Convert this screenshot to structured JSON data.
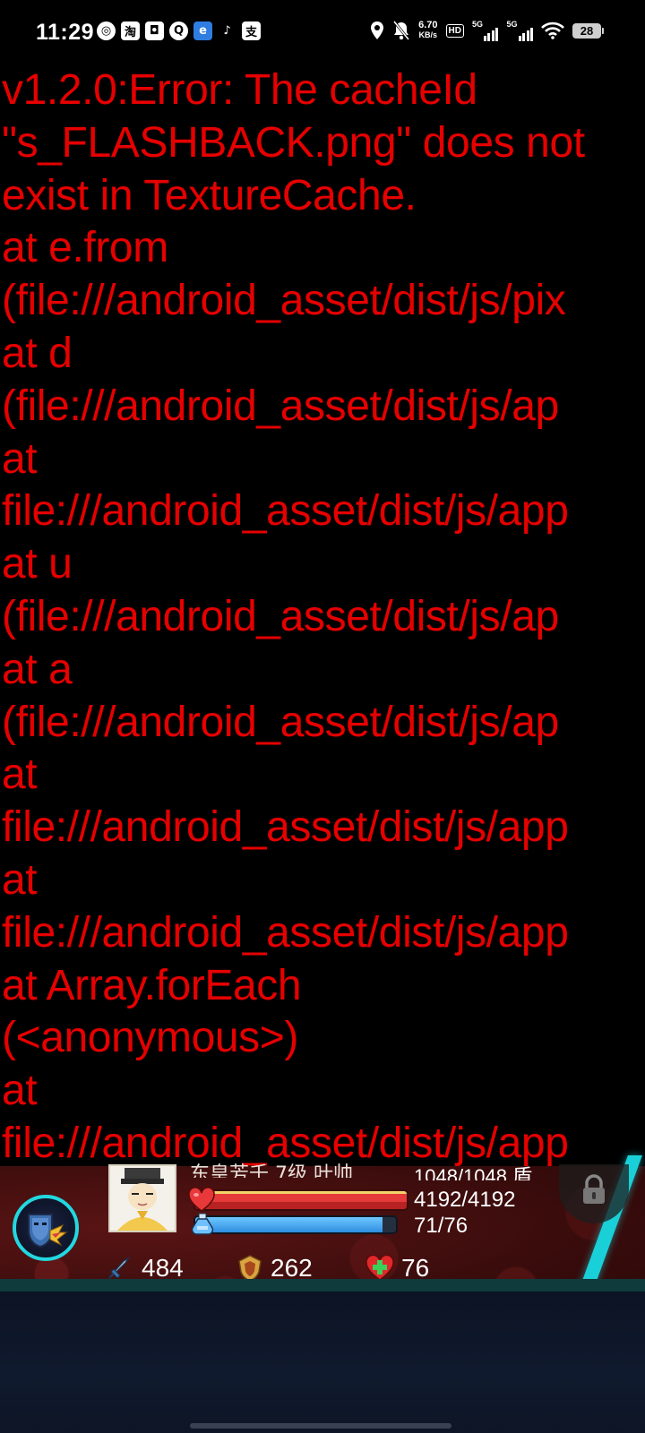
{
  "status_bar": {
    "time": "11:29",
    "app_icons": [
      "weibo-icon",
      "taobao-icon",
      "message-icon",
      "qq-browser-icon",
      "edge-icon",
      "tiktok-icon",
      "alipay-icon"
    ],
    "net_speed_value": "6.70",
    "net_speed_unit": "KB/s",
    "hd_label": "HD",
    "signal_1": "5G",
    "signal_2": "5G",
    "battery": "28"
  },
  "error": {
    "lines": [
      "v1.2.0:Error: The cacheId",
      "\"s_FLASHBACK.png\" does not",
      "exist in TextureCache.",
      "at e.from",
      "(file:///android_asset/dist/js/pix",
      "at d",
      "(file:///android_asset/dist/js/ap",
      "at",
      "file:///android_asset/dist/js/app",
      "at u",
      "(file:///android_asset/dist/js/ap",
      "at a",
      "(file:///android_asset/dist/js/ap",
      "at",
      "file:///android_asset/dist/js/app",
      "at",
      "file:///android_asset/dist/js/app",
      "at Array.forEach",
      "(<anonymous>)",
      "at",
      "file:///android_asset/dist/js/app"
    ],
    "color": "#e60000"
  },
  "hud": {
    "player_name": "东皇芳千 7级 叶帅",
    "shield_text": "1048/1048 盾",
    "hp_text": "4192/4192",
    "hp_fraction": 1.0,
    "mp_text": "71/76",
    "mp_fraction": 0.934,
    "attack": "484",
    "defense": "262",
    "heal": "76",
    "accent_color": "#22d8e0"
  }
}
